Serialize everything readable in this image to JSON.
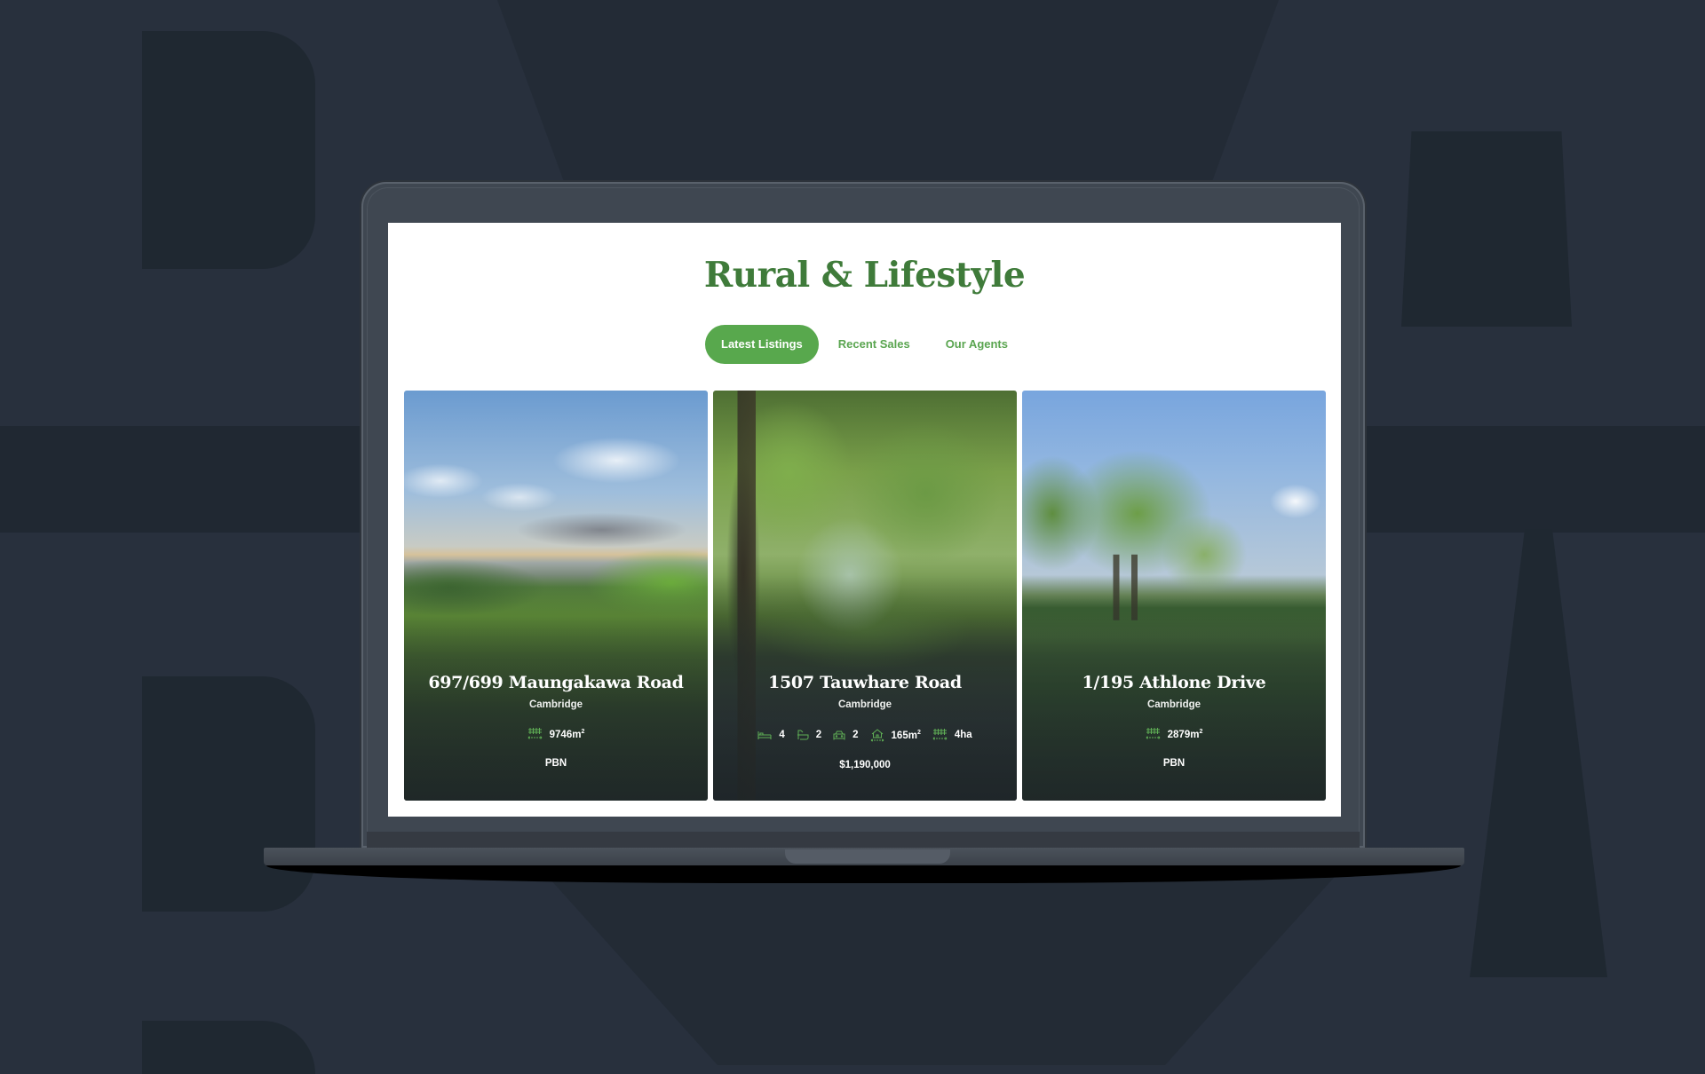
{
  "colors": {
    "background": "#28303d",
    "background_letters": "#1f2831",
    "brand_green": "#3f7b3a",
    "accent_green": "#58a84d",
    "icon_green": "#5fae55"
  },
  "background_text": "BAYLEYS",
  "page": {
    "title": "Rural & Lifestyle",
    "tabs": [
      {
        "label": "Latest Listings",
        "active": true
      },
      {
        "label": "Recent Sales",
        "active": false
      },
      {
        "label": "Our Agents",
        "active": false
      }
    ]
  },
  "listings": [
    {
      "address": "697/699 Maungakawa Road",
      "suburb": "Cambridge",
      "land_area": "9746m",
      "land_area_unit_sup": "2",
      "price": "PBN",
      "image": "rolling-green-hills-sunset-icon"
    },
    {
      "address": "1507 Tauwhare Road",
      "suburb": "Cambridge",
      "bedrooms": "4",
      "bathrooms": "2",
      "garages": "2",
      "floor_area": "165m",
      "floor_area_unit_sup": "2",
      "land_area": "4ha",
      "price": "$1,190,000",
      "image": "tree-lined-driveway-icon"
    },
    {
      "address": "1/195 Athlone Drive",
      "suburb": "Cambridge",
      "land_area": "2879m",
      "land_area_unit_sup": "2",
      "price": "PBN",
      "image": "trees-on-lawn-icon"
    }
  ]
}
